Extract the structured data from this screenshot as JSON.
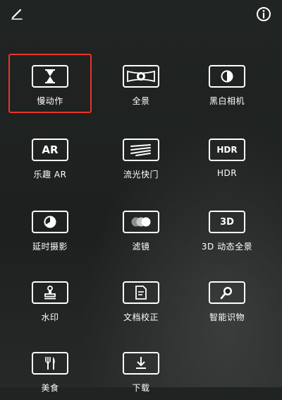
{
  "toolbar": {
    "edit_icon": "pencil-icon",
    "info_icon": "info-icon"
  },
  "modes": [
    {
      "label": "慢动作",
      "icon": "hourglass-icon"
    },
    {
      "label": "全景",
      "icon": "panorama-icon"
    },
    {
      "label": "黑白相机",
      "icon": "half-circle-icon"
    },
    {
      "label": "乐趣 AR",
      "icon": "ar-icon",
      "glyph": "AR"
    },
    {
      "label": "流光快门",
      "icon": "light-trail-icon"
    },
    {
      "label": "HDR",
      "icon": "hdr-icon",
      "glyph": "HDR"
    },
    {
      "label": "延时摄影",
      "icon": "timelapse-icon"
    },
    {
      "label": "滤镜",
      "icon": "filter-icon"
    },
    {
      "label": "3D 动态全景",
      "icon": "3d-icon",
      "glyph": "3D"
    },
    {
      "label": "水印",
      "icon": "stamp-icon"
    },
    {
      "label": "文档校正",
      "icon": "document-icon"
    },
    {
      "label": "智能识物",
      "icon": "magnifier-icon"
    },
    {
      "label": "美食",
      "icon": "cutlery-icon"
    },
    {
      "label": "下载",
      "icon": "download-icon"
    }
  ],
  "colors": {
    "background": "#1f2321",
    "highlight": "#e8342c",
    "foreground": "#ffffff"
  }
}
